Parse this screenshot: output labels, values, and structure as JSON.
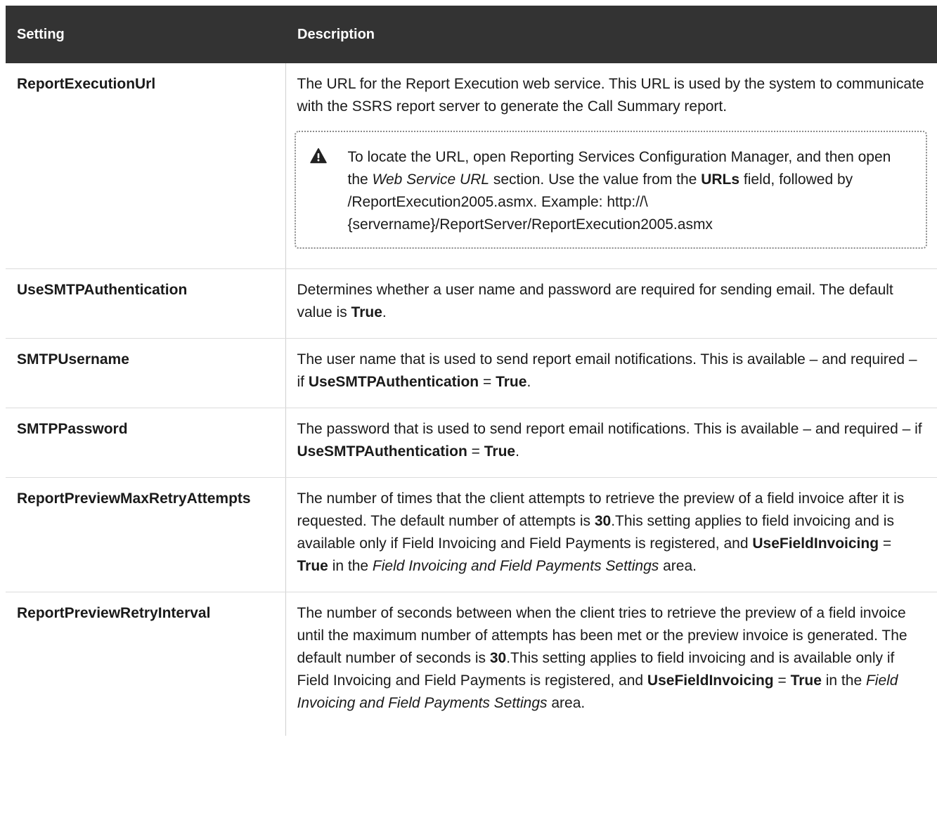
{
  "table": {
    "headers": {
      "setting": "Setting",
      "description": "Description"
    },
    "rows": [
      {
        "setting": "ReportExecutionUrl",
        "desc": "The URL for the Report Execution web service. This URL is used by the system to communicate with the SSRS report server to generate the Call Summary report.",
        "note": {
          "icon": "warning-icon",
          "text_1": "To locate the URL, open Reporting Services Configuration Manager, and then open the ",
          "em_1": "Web Service URL",
          "text_2": " section. Use the value from the ",
          "strong_1": "URLs",
          "text_3": " field, followed by /ReportExecution2005.asmx. Example: http://\\{servername}/ReportServer/ReportExecution2005.asmx"
        }
      },
      {
        "setting": "UseSMTPAuthentication",
        "desc_1": "Determines whether a user name and password are required for sending email. The default value is ",
        "strong_1": "True",
        "desc_2": "."
      },
      {
        "setting": "SMTPUsername",
        "desc_1": "The user name that is used to send report email notifications. This is available – and required – if ",
        "strong_1": "UseSMTPAuthentication",
        "desc_2": " = ",
        "strong_2": "True",
        "desc_3": "."
      },
      {
        "setting": "SMTPPassword",
        "desc_1": "The password that is used to send report email notifications. This is available – and required – if ",
        "strong_1": "UseSMTPAuthentication",
        "desc_2": " = ",
        "strong_2": "True",
        "desc_3": "."
      },
      {
        "setting": "ReportPreviewMaxRetryAttempts",
        "desc_1": "The number of times that the client attempts to retrieve the preview of a field invoice after it is requested. The default number of attempts is ",
        "strong_1": "30",
        "desc_2": ".This setting applies to field invoicing and is available only if Field Invoicing and Field Payments is registered, and ",
        "strong_2": "UseFieldInvoicing",
        "desc_3": " = ",
        "strong_3": "True",
        "desc_4": " in the ",
        "em_1": "Field Invoicing and Field Payments Settings",
        "desc_5": " area."
      },
      {
        "setting": "ReportPreviewRetryInterval",
        "desc_1": "The number of seconds between when the client tries to retrieve the preview of a field invoice until the maximum number of attempts has been met or the preview invoice is generated. The default number of seconds is ",
        "strong_1": "30",
        "desc_2": ".This setting applies to field invoicing and is available only if Field Invoicing and Field Payments is registered, and ",
        "strong_2": "UseFieldInvoicing",
        "desc_3": " = ",
        "strong_3": "True",
        "desc_4": " in the ",
        "em_1": "Field Invoicing and Field Payments Settings",
        "desc_5": " area."
      }
    ]
  }
}
